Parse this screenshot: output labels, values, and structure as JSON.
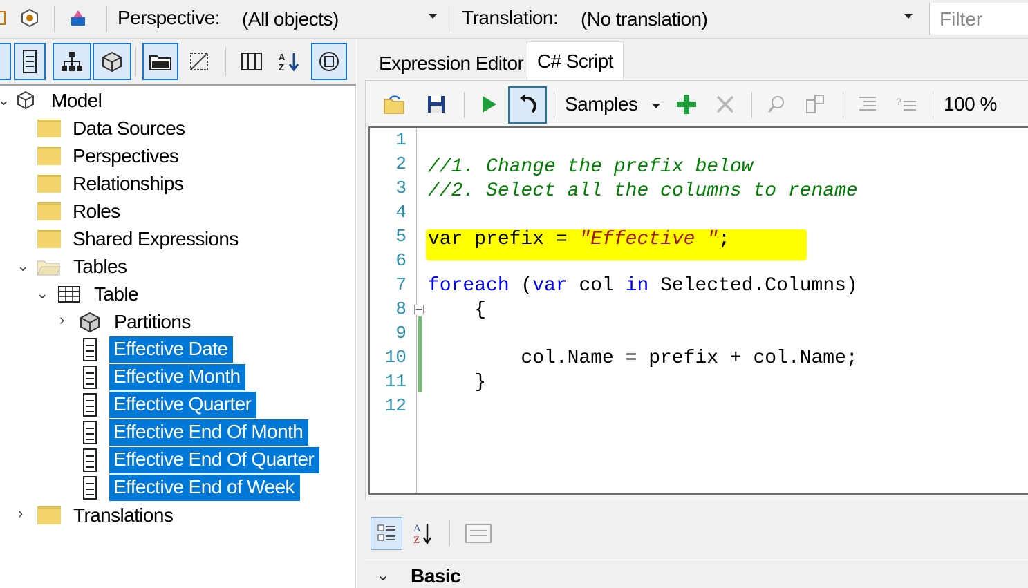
{
  "toolbar": {
    "perspective_label": "Perspective:",
    "perspective_value": "(All objects)",
    "translation_label": "Translation:",
    "translation_value": "(No translation)",
    "filter_placeholder": "Filter"
  },
  "tree": {
    "model": "Model",
    "data_sources": "Data Sources",
    "perspectives": "Perspectives",
    "relationships": "Relationships",
    "roles": "Roles",
    "shared_expressions": "Shared Expressions",
    "tables": "Tables",
    "table": "Table",
    "partitions": "Partitions",
    "columns": [
      "Effective Date",
      "Effective Month",
      "Effective Quarter",
      "Effective End Of Month",
      "Effective End Of Quarter",
      "Effective End of Week"
    ],
    "translations": "Translations"
  },
  "tabs": {
    "expression_editor": "Expression Editor",
    "csharp_script": "C# Script"
  },
  "editor": {
    "samples_label": "Samples",
    "zoom": "100 %",
    "line_numbers": [
      "1",
      "2",
      "3",
      "4",
      "5",
      "6",
      "7",
      "8",
      "9",
      "10",
      "11",
      "12"
    ],
    "code": {
      "line2": "//1. Change the prefix below",
      "line3": "//2. Select all the columns to rename",
      "line5_kw": "var",
      "line5_mid": " prefix = ",
      "line5_str": "\"Effective \"",
      "line5_end": ";",
      "line7_kw1": "foreach",
      "line7_a": " (",
      "line7_kw2": "var",
      "line7_b": " col ",
      "line7_kw3": "in",
      "line7_c": " Selected.Columns)",
      "line8": "    {",
      "line10": "        col.Name = prefix + col.Name;",
      "line11": "    }"
    },
    "highlight_color": "#ffff00"
  },
  "properties": {
    "section_basic": "Basic"
  },
  "colors": {
    "selection": "#0078d7",
    "comment": "#008000",
    "keyword": "#0000ff",
    "string": "#a31515",
    "line_number": "#2b91af"
  }
}
